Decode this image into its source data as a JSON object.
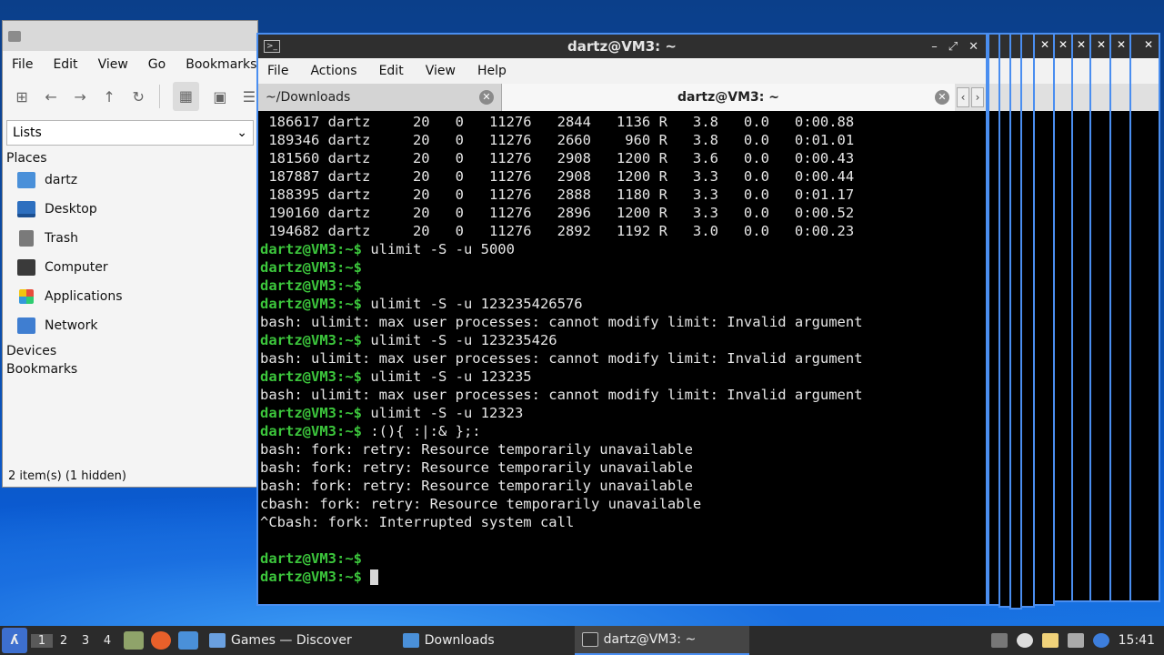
{
  "file_manager": {
    "menu": [
      "File",
      "Edit",
      "View",
      "Go",
      "Bookmarks"
    ],
    "view_select": "Lists",
    "places_heading": "Places",
    "places": [
      {
        "label": "dartz",
        "icon": "home-folder-icon"
      },
      {
        "label": "Desktop",
        "icon": "desktop-icon"
      },
      {
        "label": "Trash",
        "icon": "trash-icon"
      },
      {
        "label": "Computer",
        "icon": "computer-icon"
      },
      {
        "label": "Applications",
        "icon": "applications-icon"
      },
      {
        "label": "Network",
        "icon": "network-icon"
      }
    ],
    "devices_heading": "Devices",
    "bookmarks_heading": "Bookmarks",
    "status": "2 item(s) (1 hidden)"
  },
  "terminal": {
    "title": "dartz@VM3: ~",
    "menu": [
      "File",
      "Actions",
      "Edit",
      "View",
      "Help"
    ],
    "tabs": {
      "inactive": "~/Downloads",
      "active": "dartz@VM3: ~"
    },
    "prompt": "dartz@VM3:~$",
    "lines": [
      {
        "type": "out",
        "text": " 186617 dartz     20   0   11276   2844   1136 R   3.8   0.0   0:00.88"
      },
      {
        "type": "out",
        "text": " 189346 dartz     20   0   11276   2660    960 R   3.8   0.0   0:01.01"
      },
      {
        "type": "out",
        "text": " 181560 dartz     20   0   11276   2908   1200 R   3.6   0.0   0:00.43"
      },
      {
        "type": "out",
        "text": " 187887 dartz     20   0   11276   2908   1200 R   3.3   0.0   0:00.44"
      },
      {
        "type": "out",
        "text": " 188395 dartz     20   0   11276   2888   1180 R   3.3   0.0   0:01.17"
      },
      {
        "type": "out",
        "text": " 190160 dartz     20   0   11276   2896   1200 R   3.3   0.0   0:00.52"
      },
      {
        "type": "out",
        "text": " 194682 dartz     20   0   11276   2892   1192 R   3.0   0.0   0:00.23"
      },
      {
        "type": "cmd",
        "text": " ulimit -S -u 5000"
      },
      {
        "type": "cmd",
        "text": ""
      },
      {
        "type": "cmd",
        "text": ""
      },
      {
        "type": "cmd",
        "text": " ulimit -S -u 123235426576"
      },
      {
        "type": "out",
        "text": "bash: ulimit: max user processes: cannot modify limit: Invalid argument"
      },
      {
        "type": "cmd",
        "text": " ulimit -S -u 123235426"
      },
      {
        "type": "out",
        "text": "bash: ulimit: max user processes: cannot modify limit: Invalid argument"
      },
      {
        "type": "cmd",
        "text": " ulimit -S -u 123235"
      },
      {
        "type": "out",
        "text": "bash: ulimit: max user processes: cannot modify limit: Invalid argument"
      },
      {
        "type": "cmd",
        "text": " ulimit -S -u 12323"
      },
      {
        "type": "cmd",
        "text": " :(){ :|:& };:"
      },
      {
        "type": "out",
        "text": "bash: fork: retry: Resource temporarily unavailable"
      },
      {
        "type": "out",
        "text": "bash: fork: retry: Resource temporarily unavailable"
      },
      {
        "type": "out",
        "text": "bash: fork: retry: Resource temporarily unavailable"
      },
      {
        "type": "out",
        "text": "cbash: fork: retry: Resource temporarily unavailable"
      },
      {
        "type": "out",
        "text": "^Cbash: fork: Interrupted system call"
      },
      {
        "type": "out",
        "text": ""
      },
      {
        "type": "cmd",
        "text": ""
      },
      {
        "type": "cmd",
        "text": " ",
        "cursor": true
      }
    ]
  },
  "taskbar": {
    "workspaces": [
      "1",
      "2",
      "3",
      "4"
    ],
    "current_workspace": "1",
    "tasks": [
      {
        "label": "Games — Discover",
        "icon": "discover-icon"
      },
      {
        "label": "Downloads",
        "icon": "folder-icon"
      },
      {
        "label": "dartz@VM3: ~",
        "icon": "terminal-icon",
        "active": true
      }
    ],
    "clock": "15:41"
  }
}
